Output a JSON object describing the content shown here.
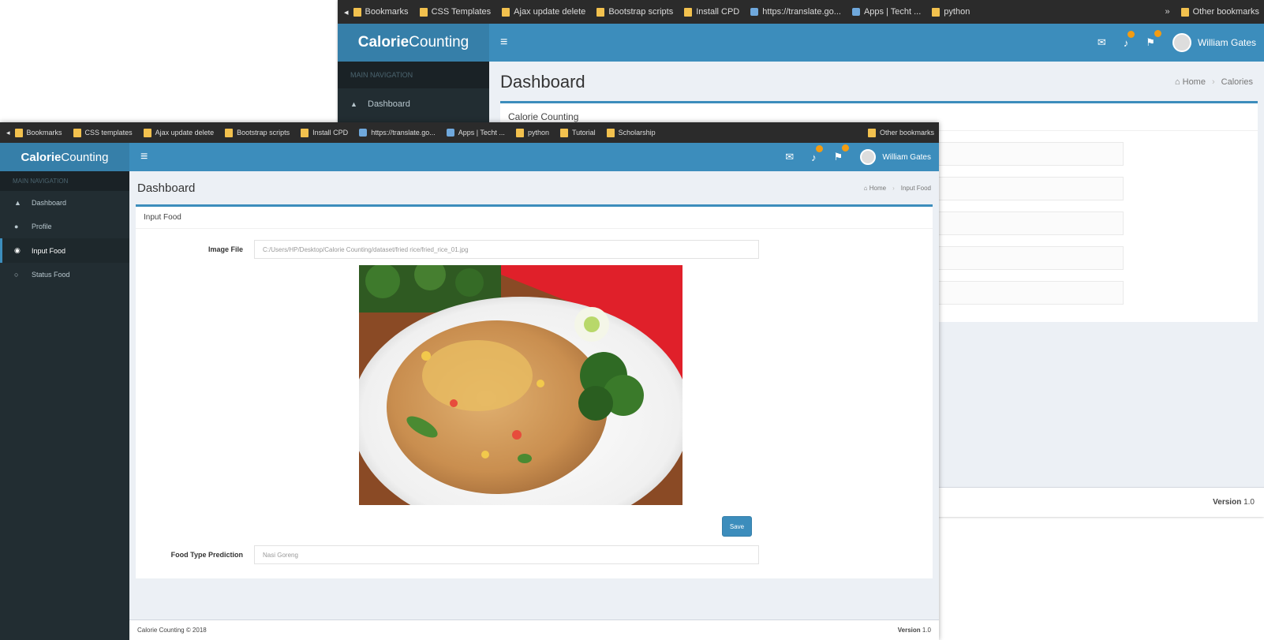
{
  "back_window": {
    "bookmarks": [
      "Bookmarks",
      "CSS Templates",
      "Ajax update delete",
      "Bootstrap scripts",
      "Install CPD",
      "https://translate.go...",
      "Apps | Techt ...",
      "python"
    ],
    "other_bookmarks": "Other bookmarks",
    "brand_bold": "Calorie",
    "brand_light": "Counting",
    "user_name": "William Gates",
    "sidebar_header": "MAIN NAVIGATION",
    "sidebar_items": [
      "Dashboard"
    ],
    "page_title": "Dashboard",
    "breadcrumb": [
      "Home",
      "Calories"
    ],
    "box_title": "Calorie Counting",
    "footer_version_label": "Version",
    "footer_version": "1.0"
  },
  "front_window": {
    "bookmarks": [
      "Bookmarks",
      "CSS templates",
      "Ajax update delete",
      "Bootstrap scripts",
      "Install CPD",
      "https://translate.go...",
      "Apps | Techt ...",
      "python",
      "Tutorial",
      "Scholarship"
    ],
    "other_bookmarks": "Other bookmarks",
    "brand_bold": "Calorie",
    "brand_light": "Counting",
    "user_name": "William Gates",
    "sidebar_header": "MAIN NAVIGATION",
    "sidebar_items": [
      "Dashboard",
      "Profile",
      "Input Food",
      "Status Food"
    ],
    "active_sidebar_index": 2,
    "page_title": "Dashboard",
    "breadcrumb": [
      "Home",
      "Input Food"
    ],
    "box_title": "Input Food",
    "image_file_label": "Image File",
    "image_file_value": "C:/Users/HP/Desktop/Calorie Counting/dataset/fried rice/fried_rice_01.jpg",
    "submit_label": "Save",
    "prediction_label": "Food Type Prediction",
    "prediction_value": "Nasi Goreng",
    "footer_copyright": "Calorie Counting © 2018",
    "footer_version_label": "Version",
    "footer_version": "1.0"
  },
  "colors": {
    "topbar": "#3c8dbc",
    "logo_bg": "#367fa9",
    "sidebar": "#222d32",
    "bookmarks_bar": "#2b2b2b",
    "content_bg": "#ecf0f5"
  },
  "icons": {
    "bookmark": "folder-icon",
    "menu": "hamburger-icon",
    "mail": "envelope-icon",
    "notify": "bell-icon",
    "flag": "flag-icon",
    "home": "home-icon",
    "nav_dashboard": "dashboard-icon",
    "nav_profile": "user-icon",
    "nav_input": "circle-icon",
    "nav_status": "circle-icon"
  }
}
